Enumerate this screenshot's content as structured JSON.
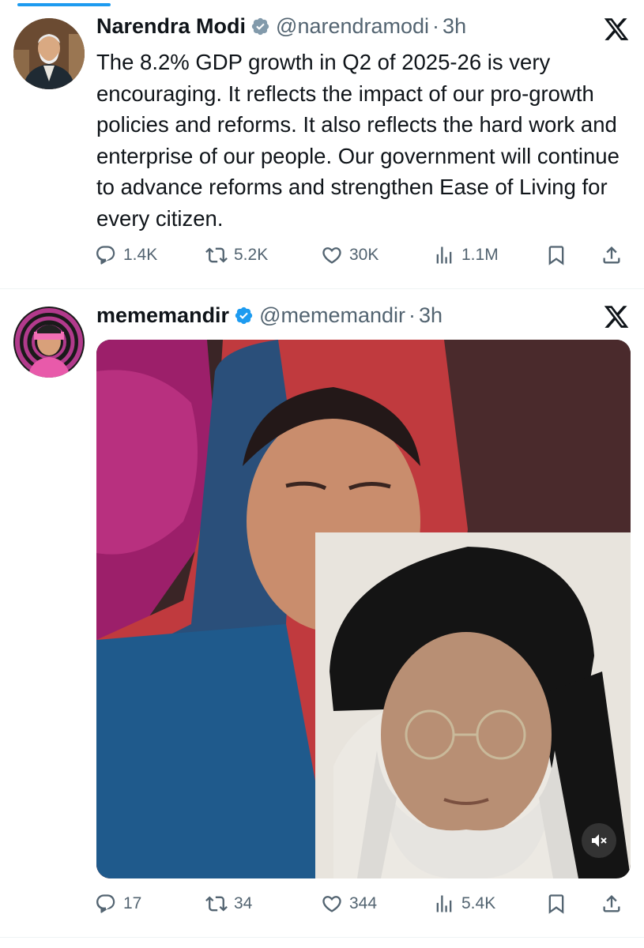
{
  "tweets": [
    {
      "author": {
        "name": "Narendra Modi",
        "handle": "@narendramodi",
        "time": "3h",
        "verified_color": "#829aab"
      },
      "text": "The 8.2% GDP growth in Q2 of 2025-26 is very encouraging. It reflects the impact of our pro-growth policies and reforms. It also reflects the hard work and enterprise of our people. Our government will continue to advance reforms and strengthen Ease of Living for every citizen.",
      "stats": {
        "replies": "1.4K",
        "reposts": "5.2K",
        "likes": "30K",
        "views": "1.1M"
      }
    },
    {
      "author": {
        "name": "mememandir",
        "handle": "@mememandir",
        "time": "3h",
        "verified_color": "#1d9bf0",
        "avatar_badge": "mememandir"
      },
      "text": "",
      "stats": {
        "replies": "17",
        "reposts": "34",
        "likes": "344",
        "views": "5.4K"
      }
    }
  ],
  "ui": {
    "separator": "·",
    "accent": "#1d9bf0",
    "secondary_text": "#536471",
    "icons": [
      "reply-icon",
      "repost-icon",
      "like-icon",
      "views-icon",
      "bookmark-icon",
      "share-icon",
      "x-logo-icon",
      "verified-icon",
      "mute-icon"
    ]
  }
}
